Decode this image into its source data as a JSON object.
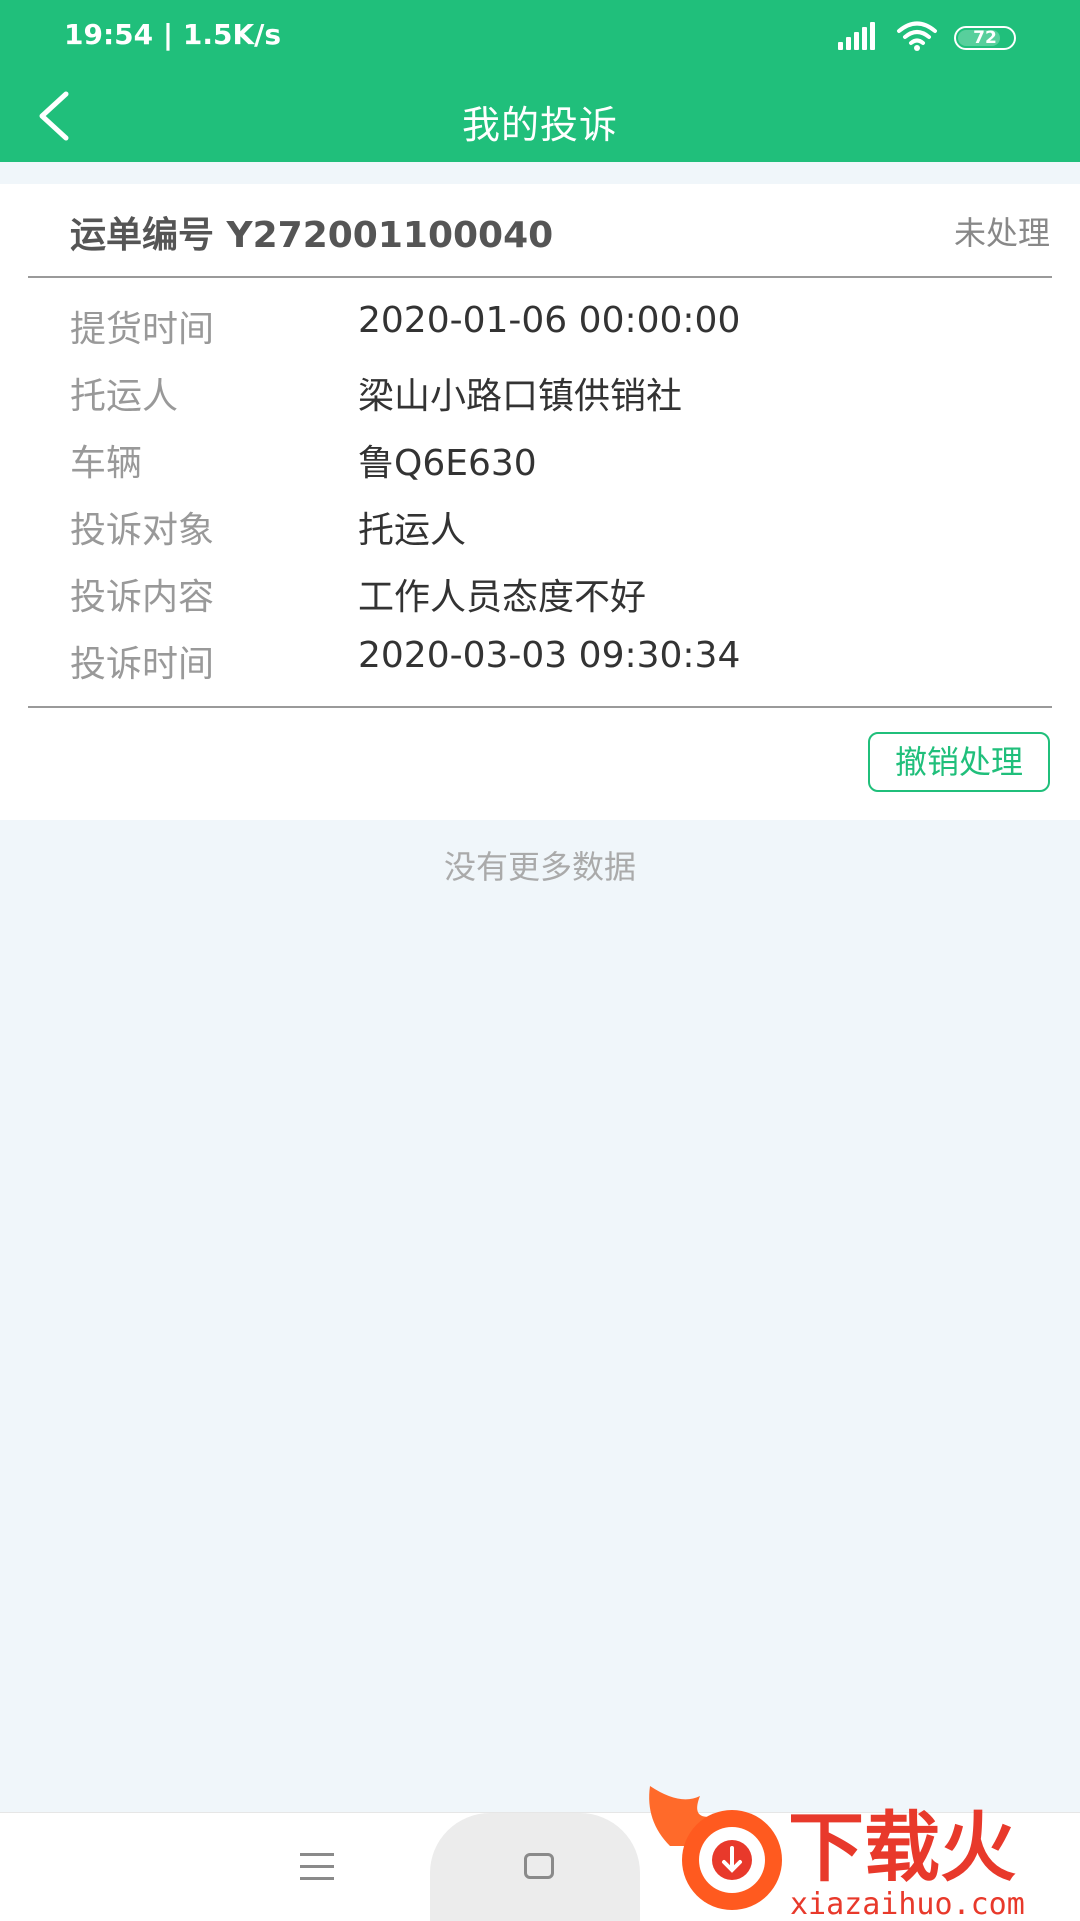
{
  "status_bar": {
    "time_speed": "19:54 | 1.5K/s",
    "battery": "72"
  },
  "header": {
    "title": "我的投诉"
  },
  "card": {
    "order_label": "运单编号 Y272001100040",
    "status": "未处理",
    "rows": [
      {
        "key": "提货时间",
        "value": "2020-01-06 00:00:00"
      },
      {
        "key": "托运人",
        "value": "梁山小路口镇供销社"
      },
      {
        "key": "车辆",
        "value": "鲁Q6E630"
      },
      {
        "key": "投诉对象",
        "value": "托运人"
      },
      {
        "key": "投诉内容",
        "value": "工作人员态度不好"
      },
      {
        "key": "投诉时间",
        "value": "2020-03-03 09:30:34"
      }
    ],
    "revoke_label": "撤销处理"
  },
  "footer": {
    "no_more": "没有更多数据"
  },
  "watermark": {
    "brand": "下载火",
    "url": "xiazaihuo.com"
  },
  "colors": {
    "accent": "#20bf7b",
    "background": "#f0f6fa"
  }
}
